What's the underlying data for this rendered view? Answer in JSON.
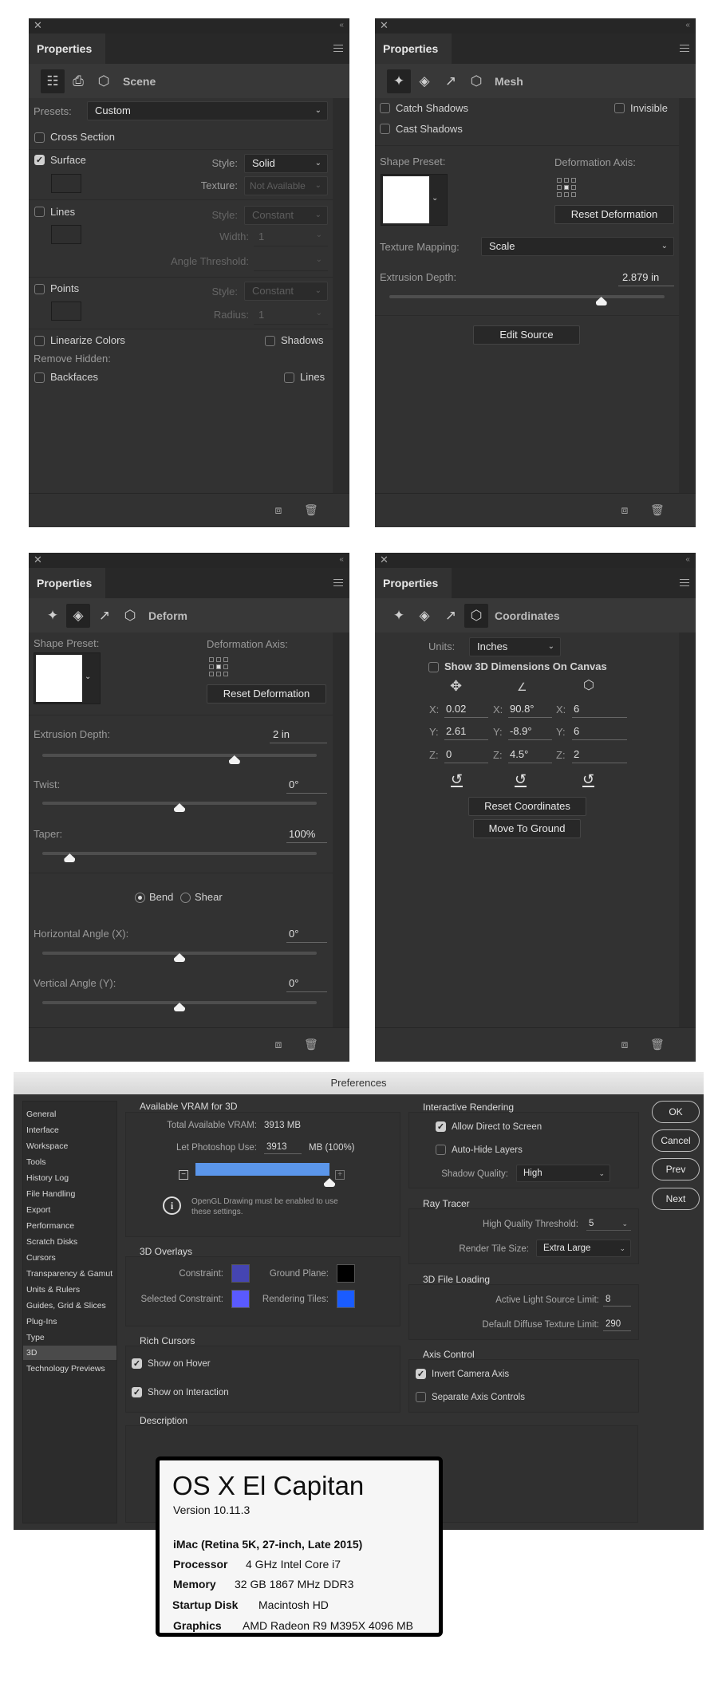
{
  "panel_common": {
    "tab": "Properties",
    "close": "✕",
    "collapse": "‹‹"
  },
  "scene_panel": {
    "section": "Scene",
    "presets_label": "Presets:",
    "presets_value": "Custom",
    "cross_section": {
      "label": "Cross Section",
      "checked": false
    },
    "surface": {
      "label": "Surface",
      "checked": true,
      "style_label": "Style:",
      "style_value": "Solid",
      "texture_label": "Texture:",
      "texture_value": "Not Available"
    },
    "lines": {
      "label": "Lines",
      "checked": false,
      "style_label": "Style:",
      "style_value": "Constant",
      "width_label": "Width:",
      "width_value": "1",
      "angle_label": "Angle Threshold:"
    },
    "points": {
      "label": "Points",
      "checked": false,
      "style_label": "Style:",
      "style_value": "Constant",
      "radius_label": "Radius:",
      "radius_value": "1"
    },
    "linearize": {
      "label": "Linearize Colors",
      "checked": false
    },
    "shadows": {
      "label": "Shadows",
      "checked": false
    },
    "remove_hidden": "Remove Hidden:",
    "backfaces": {
      "label": "Backfaces",
      "checked": false
    },
    "lines_hidden": {
      "label": "Lines",
      "checked": false
    }
  },
  "mesh_panel": {
    "section": "Mesh",
    "catch_shadows": {
      "label": "Catch Shadows",
      "checked": false
    },
    "invisible": {
      "label": "Invisible",
      "checked": false
    },
    "cast_shadows": {
      "label": "Cast Shadows",
      "checked": false
    },
    "shape_preset_label": "Shape Preset:",
    "deformation_axis_label": "Deformation Axis:",
    "reset_deformation": "Reset Deformation",
    "texture_mapping_label": "Texture Mapping:",
    "texture_mapping_value": "Scale",
    "extrusion_label": "Extrusion Depth:",
    "extrusion_value": "2.879 in",
    "extrusion_fraction": 0.77,
    "edit_source": "Edit Source"
  },
  "deform_panel": {
    "section": "Deform",
    "shape_preset_label": "Shape Preset:",
    "deformation_axis_label": "Deformation Axis:",
    "reset_deformation": "Reset Deformation",
    "extrusion_label": "Extrusion Depth:",
    "extrusion_value": "2 in",
    "extrusion_fraction": 0.7,
    "twist_label": "Twist:",
    "twist_value": "0°",
    "twist_fraction": 0.5,
    "taper_label": "Taper:",
    "taper_value": "100%",
    "taper_fraction": 0.1,
    "bend": {
      "label": "Bend",
      "selected": true
    },
    "shear": {
      "label": "Shear",
      "selected": false
    },
    "h_angle_label": "Horizontal Angle (X):",
    "h_angle_value": "0°",
    "h_angle_fraction": 0.5,
    "v_angle_label": "Vertical Angle (Y):",
    "v_angle_value": "0°",
    "v_angle_fraction": 0.5
  },
  "coords_panel": {
    "section": "Coordinates",
    "units_label": "Units:",
    "units_value": "Inches",
    "show_dims": {
      "label": "Show 3D Dimensions On Canvas",
      "checked": false
    },
    "position": {
      "x_label": "X:",
      "x": "0.02",
      "y_label": "Y:",
      "y": "2.61",
      "z_label": "Z:",
      "z": "0"
    },
    "rotation": {
      "x_label": "X:",
      "x": "90.8°",
      "y_label": "Y:",
      "y": "-8.9°",
      "z_label": "Z:",
      "z": "4.5°"
    },
    "scale": {
      "x_label": "X:",
      "x": "6",
      "y_label": "Y:",
      "y": "6",
      "z_label": "Z:",
      "z": "2"
    },
    "reset_coordinates": "Reset Coordinates",
    "move_to_ground": "Move To Ground"
  },
  "preferences": {
    "title": "Preferences",
    "sidebar": [
      "General",
      "Interface",
      "Workspace",
      "Tools",
      "History Log",
      "File Handling",
      "Export",
      "Performance",
      "Scratch Disks",
      "Cursors",
      "Transparency & Gamut",
      "Units & Rulers",
      "Guides, Grid & Slices",
      "Plug-Ins",
      "Type",
      "3D",
      "Technology Previews"
    ],
    "selected": "3D",
    "vram": {
      "title": "Available VRAM for 3D",
      "total_label": "Total Available VRAM:",
      "total_value": "3913 MB",
      "use_label": "Let Photoshop Use:",
      "use_value": "3913",
      "use_unit": "MB (100%)",
      "use_percent": 100,
      "info": "OpenGL Drawing must be enabled to use",
      "info2": "these settings."
    },
    "overlays": {
      "title": "3D Overlays",
      "constraint_label": "Constraint:",
      "constraint_color": "#4545b2",
      "ground_label": "Ground Plane:",
      "ground_color": "#000000",
      "selected_label": "Selected Constraint:",
      "selected_color": "#5a5aff",
      "tiles_label": "Rendering Tiles:",
      "tiles_color": "#1a5cff"
    },
    "rich_cursors": {
      "title": "Rich Cursors",
      "hover": {
        "label": "Show on Hover",
        "checked": true
      },
      "interaction": {
        "label": "Show on Interaction",
        "checked": true
      }
    },
    "description": {
      "title": "Description"
    },
    "interactive": {
      "title": "Interactive Rendering",
      "direct": {
        "label": "Allow Direct to Screen",
        "checked": true
      },
      "autohide": {
        "label": "Auto-Hide Layers",
        "checked": false
      },
      "shadow_label": "Shadow Quality:",
      "shadow_value": "High"
    },
    "ray": {
      "title": "Ray Tracer",
      "hq_label": "High Quality Threshold:",
      "hq_value": "5",
      "tile_label": "Render Tile Size:",
      "tile_value": "Extra Large"
    },
    "loading": {
      "title": "3D File Loading",
      "light_label": "Active Light Source Limit:",
      "light_value": "8",
      "texture_label": "Default Diffuse Texture Limit:",
      "texture_value": "290"
    },
    "axis": {
      "title": "Axis Control",
      "invert": {
        "label": "Invert Camera Axis",
        "checked": true
      },
      "separate": {
        "label": "Separate Axis Controls",
        "checked": false
      }
    },
    "buttons": {
      "ok": "OK",
      "cancel": "Cancel",
      "prev": "Prev",
      "next": "Next"
    }
  },
  "about": {
    "os": "OS X El Capitan",
    "version": "Version 10.11.3",
    "model": "iMac (Retina 5K, 27-inch, Late 2015)",
    "processor_label": "Processor",
    "processor": "4 GHz Intel Core i7",
    "memory_label": "Memory",
    "memory": "32 GB 1867 MHz DDR3",
    "disk_label": "Startup Disk",
    "disk": "Macintosh HD",
    "graphics_label": "Graphics",
    "graphics": "AMD Radeon R9 M395X 4096 MB"
  }
}
